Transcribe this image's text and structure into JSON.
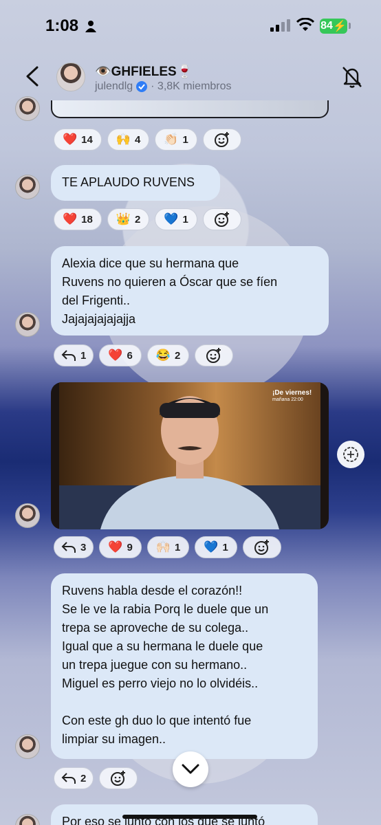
{
  "status_bar": {
    "time": "1:08",
    "battery": "84"
  },
  "header": {
    "channel_name": "👁️GHFIELES🍷",
    "owner": "julendlg",
    "members": "· 3,8K miembros"
  },
  "posts": [
    {
      "reactions": [
        {
          "emoji": "❤️",
          "count": "14"
        },
        {
          "emoji": "🙌",
          "count": "4"
        },
        {
          "emoji": "👏🏻",
          "count": "1"
        }
      ]
    },
    {
      "text": "TE APLAUDO RUVENS",
      "reactions": [
        {
          "emoji": "❤️",
          "count": "18"
        },
        {
          "emoji": "👑",
          "count": "2"
        },
        {
          "emoji": "💙",
          "count": "1"
        }
      ]
    },
    {
      "text": "Alexia dice que su hermana que\nRuvens no quieren a Óscar que se fíen\ndel Frigenti..\nJajajajajajajja",
      "replies": "1",
      "reactions": [
        {
          "emoji": "❤️",
          "count": "6"
        },
        {
          "emoji": "😂",
          "count": "2"
        }
      ]
    },
    {
      "video": {
        "label": "¡De viernes!",
        "sub": "mañana  22:00"
      },
      "replies": "3",
      "reactions": [
        {
          "emoji": "❤️",
          "count": "9"
        },
        {
          "emoji": "🙌🏻",
          "count": "1"
        },
        {
          "emoji": "💙",
          "count": "1"
        }
      ]
    },
    {
      "text": "Ruvens habla desde el corazón!!\nSe le ve la rabia Porq le duele que un\ntrepa se aproveche de su colega..\nIgual que a su hermana le duele que\nun trepa juegue con su hermano..\nMiguel es perro viejo no lo olvidéis..\n\nCon este gh duo lo que intentó fue\nlimpiar su imagen..",
      "replies": "2"
    },
    {
      "text": "Por eso se juntó con los que se juntó"
    }
  ],
  "colors": {
    "bubble": "#dce8f7",
    "battery": "#36c759"
  }
}
